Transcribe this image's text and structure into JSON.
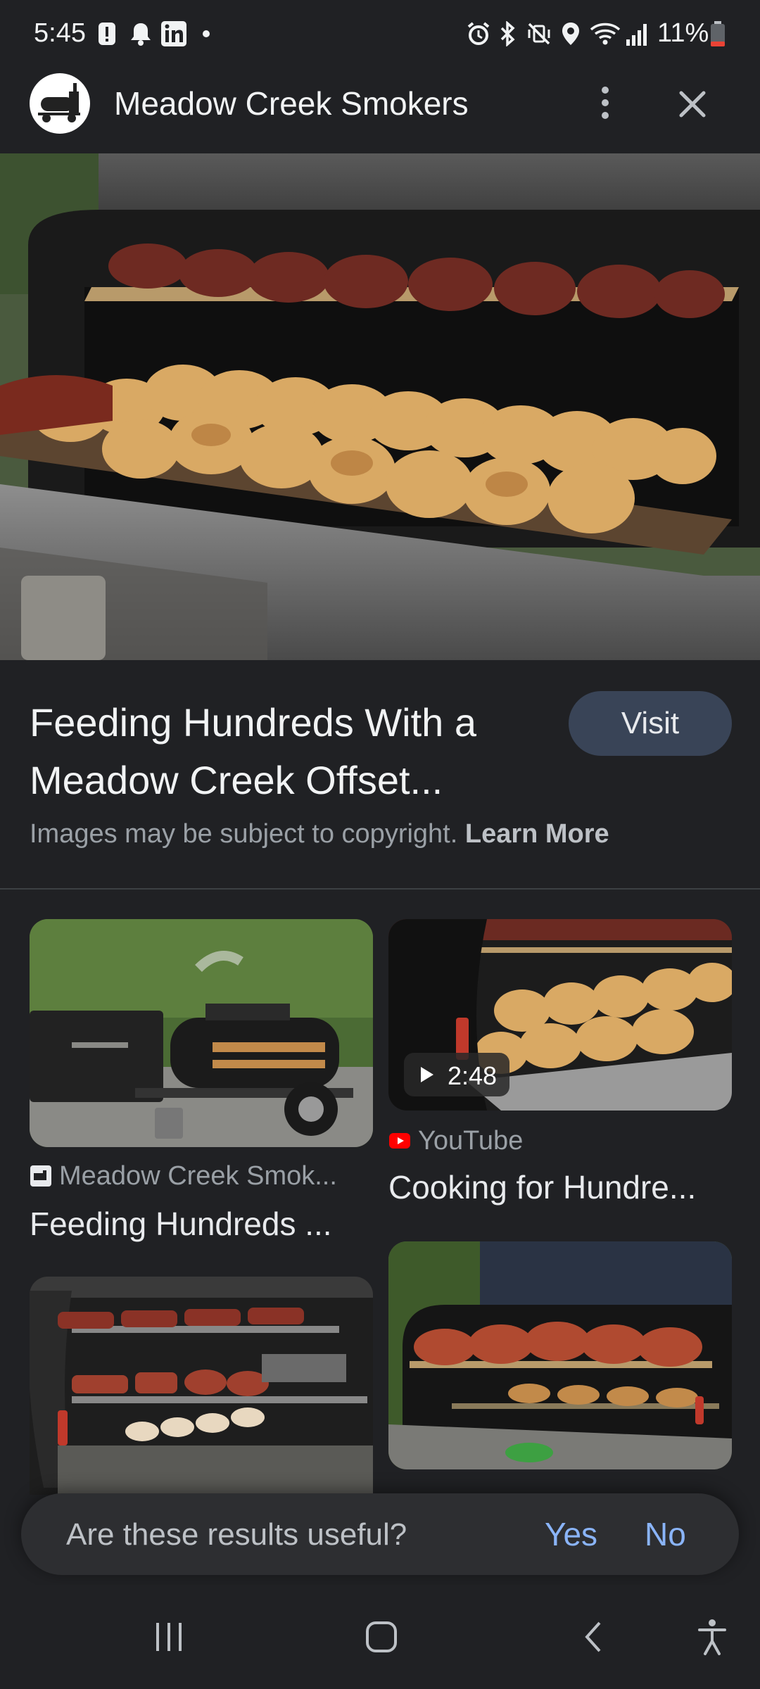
{
  "status_bar": {
    "time": "5:45",
    "battery": "11%"
  },
  "header": {
    "site_name": "Meadow Creek Smokers"
  },
  "result": {
    "title_line1": "Feeding Hundreds With a",
    "title_line2": "Meadow Creek Offset...",
    "visit_label": "Visit",
    "copyright_text": "Images may be subject to copyright.",
    "learn_more_label": "Learn More"
  },
  "related": [
    {
      "source": "Meadow Creek Smok...",
      "title": "Feeding Hundreds ...",
      "source_icon": "site-favicon"
    },
    {
      "source": "YouTube",
      "title": "Cooking for Hundre...",
      "duration": "2:48",
      "source_icon": "youtube-icon"
    }
  ],
  "feedback": {
    "question": "Are these results useful?",
    "yes_label": "Yes",
    "no_label": "No"
  },
  "colors": {
    "background": "#202124",
    "accent_link": "#8ab4f8",
    "visit_button": "#394457"
  }
}
